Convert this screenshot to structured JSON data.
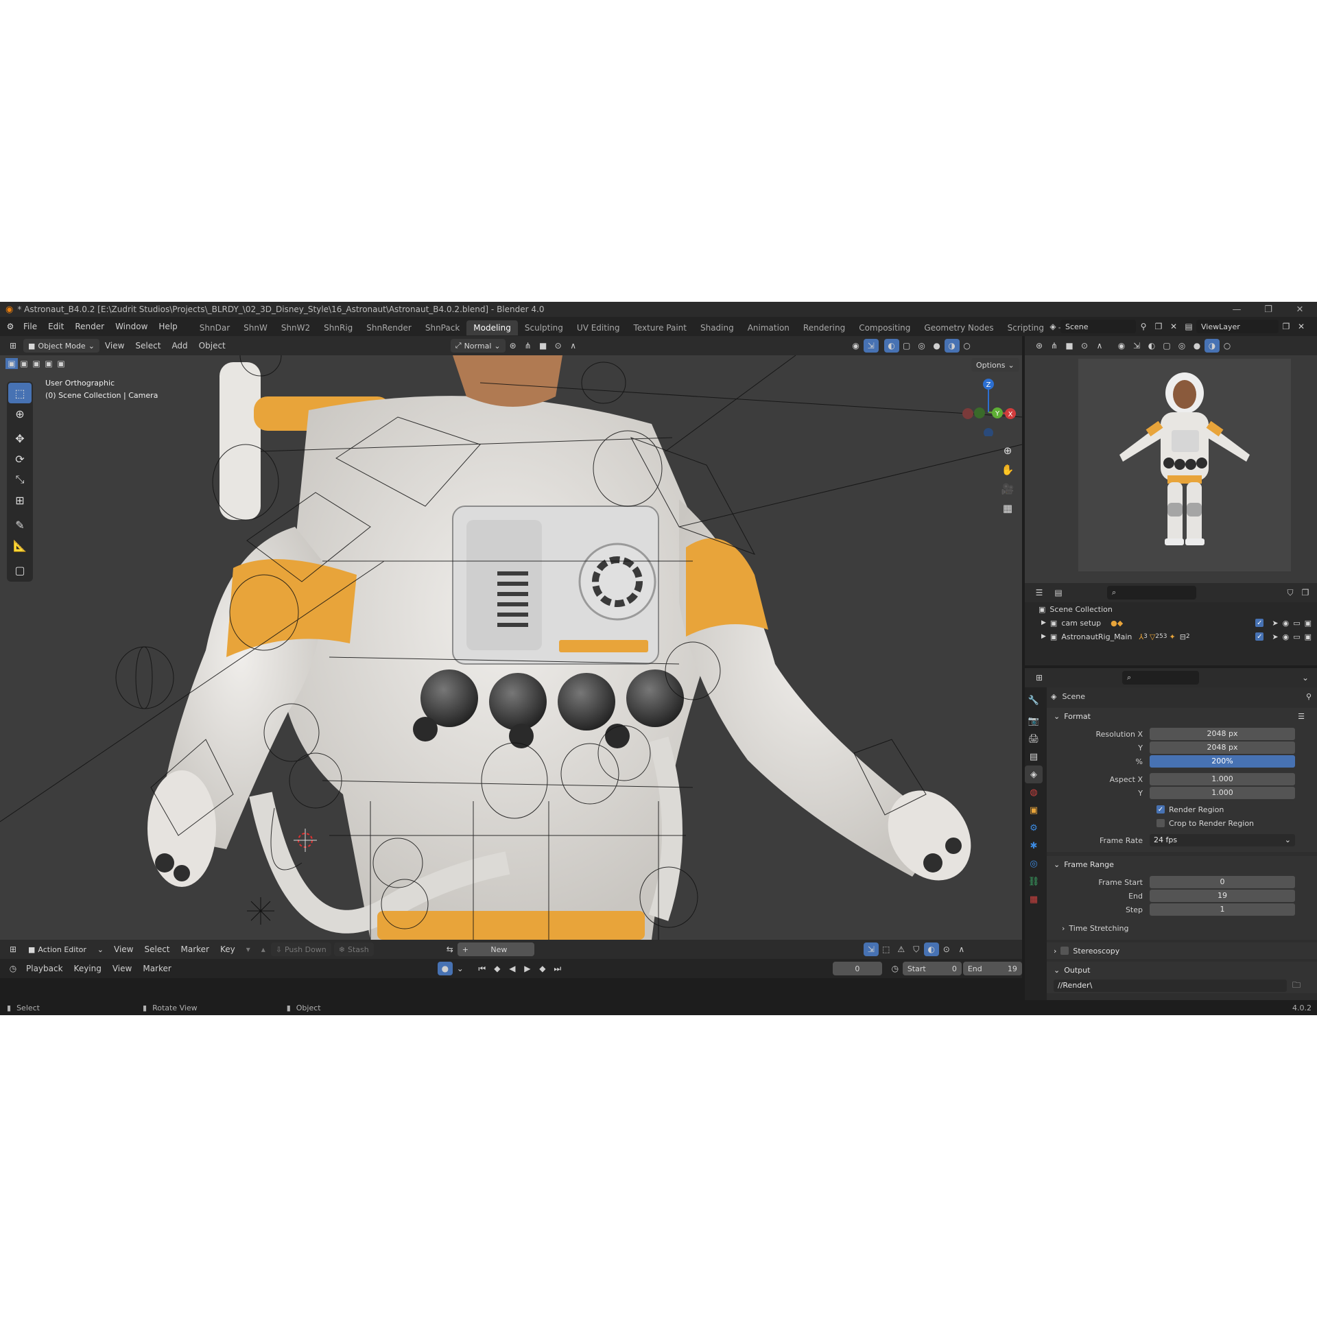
{
  "title": "* Astronaut_B4.0.2 [E:\\Zudrit Studios\\Projects\\_BLRDY_\\02_3D_Disney_Style\\16_Astronaut\\Astronaut_B4.0.2.blend] - Blender 4.0",
  "menu": [
    "File",
    "Edit",
    "Render",
    "Window",
    "Help"
  ],
  "workspaces": [
    "ShnDar",
    "ShnW",
    "ShnW2",
    "ShnRig",
    "ShnRender",
    "ShnPack",
    "Modeling",
    "Sculpting",
    "UV Editing",
    "Texture Paint",
    "Shading",
    "Animation",
    "Rendering",
    "Compositing",
    "Geometry Nodes",
    "Scripting",
    "+"
  ],
  "active_workspace": "Modeling",
  "scene_name": "Scene",
  "view_layer": "ViewLayer",
  "viewport": {
    "mode": "Object Mode",
    "menus": [
      "View",
      "Select",
      "Add",
      "Object"
    ],
    "orientation": "Normal",
    "options_label": "Options",
    "view_name": "User Orthographic",
    "collection_info": "(0) Scene Collection | Camera",
    "gizmo": {
      "z": "Z",
      "y": "Y",
      "x": "X"
    }
  },
  "outliner": {
    "root": "Scene Collection",
    "items": [
      {
        "name": "cam setup"
      },
      {
        "name": "AstronautRig_Main",
        "badges": [
          "3",
          "253",
          "2"
        ]
      }
    ]
  },
  "properties": {
    "context": "Scene",
    "format": {
      "header": "Format",
      "resolution_x_label": "Resolution X",
      "resolution_x": "2048 px",
      "y_label": "Y",
      "resolution_y": "2048 px",
      "pct_label": "%",
      "percent": "200%",
      "aspect_x_label": "Aspect X",
      "aspect_x": "1.000",
      "aspect_y": "1.000",
      "render_region": "Render Region",
      "crop": "Crop to Render Region",
      "frame_rate_label": "Frame Rate",
      "frame_rate": "24 fps"
    },
    "frame_range": {
      "header": "Frame Range",
      "start_label": "Frame Start",
      "start": "0",
      "end_label": "End",
      "end": "19",
      "step_label": "Step",
      "step": "1"
    },
    "time_stretching": "Time Stretching",
    "stereoscopy": "Stereoscopy",
    "output": "Output",
    "output_path": "//Render\\"
  },
  "action_editor": {
    "mode": "Action Editor",
    "menus": [
      "View",
      "Select",
      "Marker",
      "Key"
    ],
    "push_down": "Push Down",
    "stash": "Stash",
    "new_label": "New"
  },
  "timeline": {
    "menus": [
      "Playback",
      "Keying",
      "View",
      "Marker"
    ],
    "current_frame": "0",
    "start_label": "Start",
    "start": "0",
    "end_label": "End",
    "end": "19"
  },
  "statusbar": {
    "select": "Select",
    "rotate": "Rotate View",
    "object": "Object",
    "version": "4.0.2"
  },
  "colors": {
    "accent": "#4772b3",
    "orange": "#e8a43a",
    "suit": "#e6e4e1"
  }
}
